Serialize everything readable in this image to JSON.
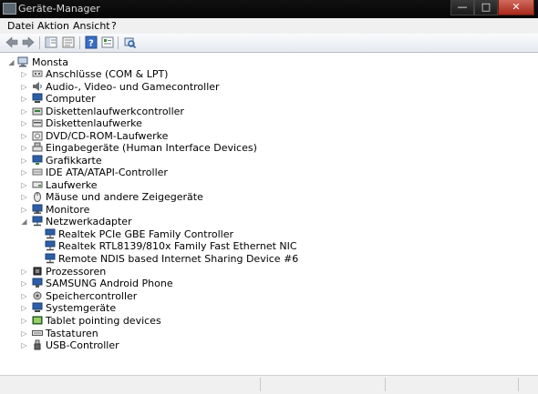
{
  "window": {
    "title": "Geräte-Manager",
    "buttons": {
      "minimize": "—",
      "maximize": "□",
      "close": "✕"
    }
  },
  "menu": [
    "Datei",
    "Aktion",
    "Ansicht",
    "?"
  ],
  "toolbar": {
    "icons": [
      "back-arrow-icon",
      "forward-arrow-icon",
      "tree-view-icon",
      "properties-icon",
      "help-icon",
      "details-icon",
      "scan-hardware-icon"
    ]
  },
  "tree": {
    "root": "Monsta",
    "categories": [
      {
        "label": "Anschlüsse (COM & LPT)",
        "icon": "port-icon"
      },
      {
        "label": "Audio-, Video- und Gamecontroller",
        "icon": "speaker-icon"
      },
      {
        "label": "Computer",
        "icon": "computer-icon"
      },
      {
        "label": "Diskettenlaufwerkcontroller",
        "icon": "floppy-controller-icon"
      },
      {
        "label": "Diskettenlaufwerke",
        "icon": "floppy-drive-icon"
      },
      {
        "label": "DVD/CD-ROM-Laufwerke",
        "icon": "dvd-drive-icon"
      },
      {
        "label": "Eingabegeräte (Human Interface Devices)",
        "icon": "hid-icon"
      },
      {
        "label": "Grafikkarte",
        "icon": "display-adapter-icon"
      },
      {
        "label": "IDE ATA/ATAPI-Controller",
        "icon": "ide-controller-icon"
      },
      {
        "label": "Laufwerke",
        "icon": "disk-drive-icon"
      },
      {
        "label": "Mäuse und andere Zeigegeräte",
        "icon": "mouse-icon"
      },
      {
        "label": "Monitore",
        "icon": "monitor-icon"
      },
      {
        "label": "Netzwerkadapter",
        "icon": "network-adapter-icon",
        "expanded": true,
        "children": [
          "Realtek PCIe GBE Family Controller",
          "Realtek RTL8139/810x Family Fast Ethernet NIC",
          "Remote NDIS based Internet Sharing Device #6"
        ]
      },
      {
        "label": "Prozessoren",
        "icon": "processor-icon"
      },
      {
        "label": "SAMSUNG Android Phone",
        "icon": "phone-icon"
      },
      {
        "label": "Speichercontroller",
        "icon": "storage-controller-icon"
      },
      {
        "label": "Systemgeräte",
        "icon": "system-devices-icon"
      },
      {
        "label": "Tablet pointing devices",
        "icon": "tablet-icon"
      },
      {
        "label": "Tastaturen",
        "icon": "keyboard-icon"
      },
      {
        "label": "USB-Controller",
        "icon": "usb-icon"
      }
    ]
  },
  "colors": {
    "titlebar": "#0a0a0a",
    "close_button": "#c0392b",
    "device_icon_blue": "#2d5fa8"
  }
}
